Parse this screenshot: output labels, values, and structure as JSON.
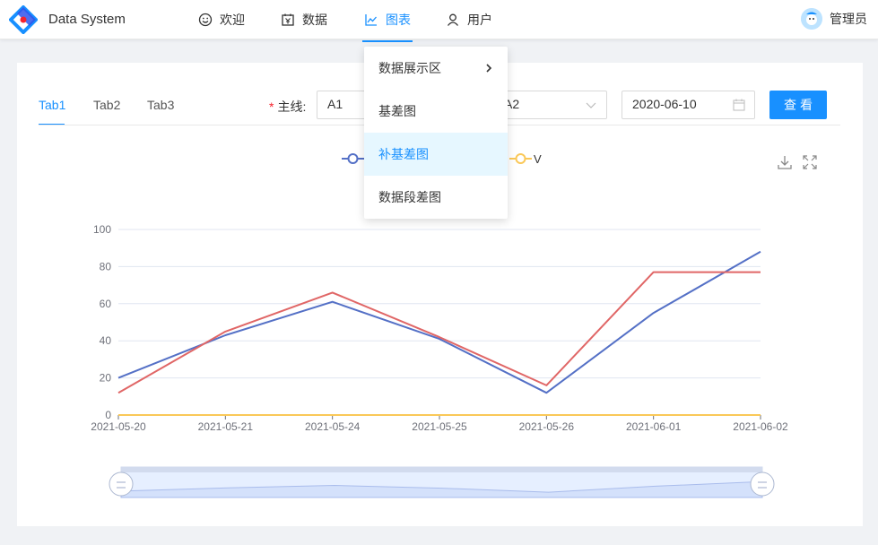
{
  "app": {
    "title": "Data System"
  },
  "nav": [
    {
      "label": "欢迎",
      "icon": "smile-icon"
    },
    {
      "label": "数据",
      "icon": "yen-calendar-icon"
    },
    {
      "label": "图表",
      "icon": "line-chart-icon",
      "active": true
    },
    {
      "label": "用户",
      "icon": "user-icon"
    }
  ],
  "user": {
    "name": "管理员"
  },
  "tabs": [
    "Tab1",
    "Tab2",
    "Tab3"
  ],
  "form": {
    "main_label": "主线:",
    "main_value": "A1",
    "second_value": "A2",
    "date_value": "2020-06-10",
    "button_label": "查看"
  },
  "dropdown": {
    "items": [
      {
        "label": "数据展示区",
        "has_submenu": true
      },
      {
        "label": "基差图"
      },
      {
        "label": "补基差图",
        "highlighted": true
      },
      {
        "label": "数据段差图"
      }
    ]
  },
  "colors": {
    "accent": "#1890ff",
    "series_blue": "#5470c6",
    "series_red": "#e06666",
    "series_orange": "#fac858"
  },
  "chart_data": {
    "type": "line",
    "x": [
      "2021-05-20",
      "2021-05-21",
      "2021-05-24",
      "2021-05-25",
      "2021-05-26",
      "2021-06-01",
      "2021-06-02"
    ],
    "series": [
      {
        "values": [
          20,
          43,
          61,
          41,
          12,
          55,
          88
        ],
        "color": "#5470c6"
      },
      {
        "values": [
          12,
          45,
          66,
          42,
          16,
          77,
          77
        ],
        "color": "#e06666"
      },
      {
        "name": "V",
        "values": [
          0,
          0,
          0,
          0,
          0,
          0,
          0
        ],
        "color": "#fac858"
      }
    ],
    "yticks": [
      0,
      20,
      40,
      60,
      80,
      100
    ],
    "ylim": [
      0,
      100
    ],
    "grid": true,
    "legend": "top-center",
    "datazoom": true
  }
}
